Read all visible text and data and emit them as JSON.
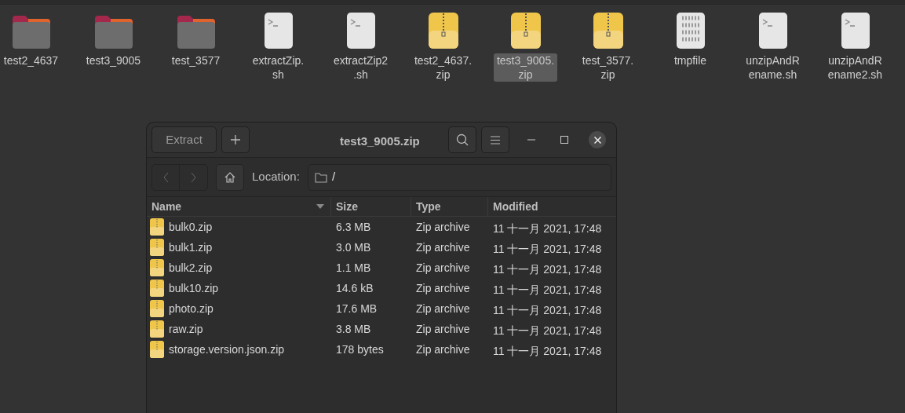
{
  "desktop_icons": [
    {
      "kind": "folder",
      "label_lines": [
        "test2_4637"
      ],
      "selected": false
    },
    {
      "kind": "folder",
      "label_lines": [
        "test3_9005"
      ],
      "selected": false
    },
    {
      "kind": "folder",
      "label_lines": [
        "test_3577"
      ],
      "selected": false
    },
    {
      "kind": "script",
      "label_lines": [
        "extractZip.",
        "sh"
      ],
      "selected": false
    },
    {
      "kind": "script",
      "label_lines": [
        "extractZip2",
        ".sh"
      ],
      "selected": false
    },
    {
      "kind": "zip",
      "label_lines": [
        "test2_4637.",
        "zip"
      ],
      "selected": false
    },
    {
      "kind": "zip",
      "label_lines": [
        "test3_9005.",
        "zip"
      ],
      "selected": true
    },
    {
      "kind": "zip",
      "label_lines": [
        "test_3577.",
        "zip"
      ],
      "selected": false
    },
    {
      "kind": "binary",
      "label_lines": [
        "tmpfile"
      ],
      "selected": false
    },
    {
      "kind": "script",
      "label_lines": [
        "unzipAndR",
        "ename.sh"
      ],
      "selected": false
    },
    {
      "kind": "script",
      "label_lines": [
        "unzipAndR",
        "ename2.sh"
      ],
      "selected": false
    }
  ],
  "window": {
    "title": "test3_9005.zip",
    "extract_button": "Extract",
    "location_label": "Location:",
    "location_path": "/"
  },
  "table": {
    "columns": [
      {
        "label": "Name",
        "sorted": true
      },
      {
        "label": "Size",
        "sorted": false
      },
      {
        "label": "Type",
        "sorted": false
      },
      {
        "label": "Modified",
        "sorted": false
      }
    ],
    "rows": [
      [
        "bulk0.zip",
        "6.3 MB",
        "Zip archive",
        "11 十一月 2021, 17:48"
      ],
      [
        "bulk1.zip",
        "3.0 MB",
        "Zip archive",
        "11 十一月 2021, 17:48"
      ],
      [
        "bulk2.zip",
        "1.1 MB",
        "Zip archive",
        "11 十一月 2021, 17:48"
      ],
      [
        "bulk10.zip",
        "14.6 kB",
        "Zip archive",
        "11 十一月 2021, 17:48"
      ],
      [
        "photo.zip",
        "17.6 MB",
        "Zip archive",
        "11 十一月 2021, 17:48"
      ],
      [
        "raw.zip",
        "3.8 MB",
        "Zip archive",
        "11 十一月 2021, 17:48"
      ],
      [
        "storage.version.json.zip",
        "178 bytes",
        "Zip archive",
        "11 十一月 2021, 17:48"
      ]
    ]
  }
}
